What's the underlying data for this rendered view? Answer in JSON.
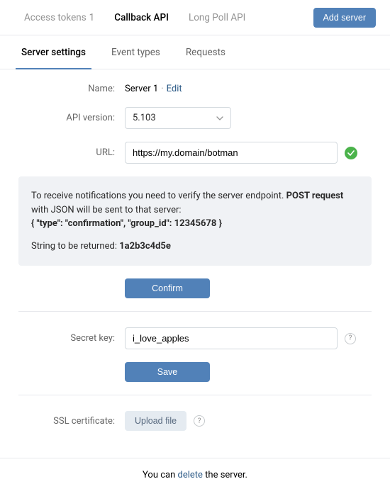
{
  "top_tabs": {
    "access_tokens": {
      "label": "Access tokens",
      "badge": "1"
    },
    "callback_api": {
      "label": "Callback API"
    },
    "long_poll": {
      "label": "Long Poll API"
    },
    "add_server_btn": "Add server"
  },
  "sub_tabs": {
    "server_settings": "Server settings",
    "event_types": "Event types",
    "requests": "Requests"
  },
  "form": {
    "name_label": "Name:",
    "name_value": "Server 1",
    "edit_label": "Edit",
    "api_version_label": "API version:",
    "api_version_value": "5.103",
    "url_label": "URL:",
    "url_value": "https://my.domain/botman",
    "secret_label": "Secret key:",
    "secret_value": "i_love_apples",
    "ssl_label": "SSL certificate:",
    "upload_btn": "Upload file",
    "confirm_btn": "Confirm",
    "save_btn": "Save"
  },
  "info": {
    "line1a": "To receive notifications you need to verify the server endpoint. ",
    "line1b": "POST request",
    "line1c": " with JSON will be sent to that server:",
    "json_sample": "{ \"type\": \"confirmation\", \"group_id\": 12345678 }",
    "line2a": "String to be returned: ",
    "line2b": "1a2b3c4d5e"
  },
  "footer": {
    "prefix": "You can ",
    "delete": "delete",
    "suffix": " the server."
  }
}
